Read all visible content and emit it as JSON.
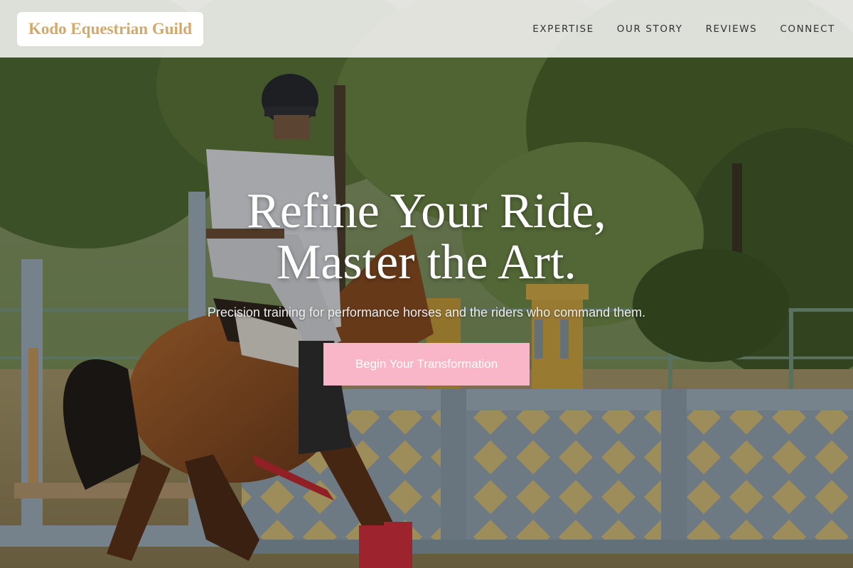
{
  "brand": {
    "name": "Kodo Equestrian Guild"
  },
  "nav": {
    "items": [
      {
        "label": "EXPERTISE"
      },
      {
        "label": "OUR STORY"
      },
      {
        "label": "REVIEWS"
      },
      {
        "label": "CONNECT"
      }
    ]
  },
  "hero": {
    "title_line1": "Refine Your Ride,",
    "title_line2": "Master the Art.",
    "subtitle": "Precision training for performance horses and the riders who command them.",
    "cta_label": "Begin Your Transformation",
    "background_image": "horse-jumping-arena-photo"
  },
  "colors": {
    "logo_text": "#d4a869",
    "cta_background": "#f9b6c8",
    "header_background": "#f4f4f2"
  }
}
